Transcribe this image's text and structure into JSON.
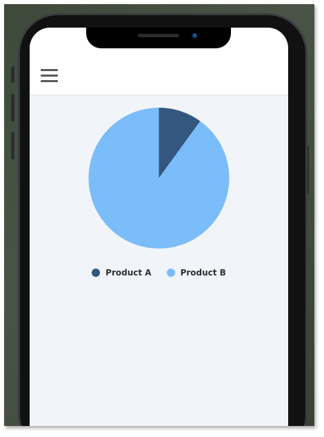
{
  "app": {
    "menu_icon": "hamburger-menu-icon"
  },
  "colors": {
    "product_a": "#34577f",
    "product_b": "#7bbcfb",
    "screen_bg": "#f1f4f8"
  },
  "chart_data": {
    "type": "pie",
    "categories": [
      "Product A",
      "Product B"
    ],
    "values": [
      10,
      90
    ],
    "colors": [
      "#34577f",
      "#7bbcfb"
    ],
    "title": "",
    "legend_position": "bottom"
  }
}
